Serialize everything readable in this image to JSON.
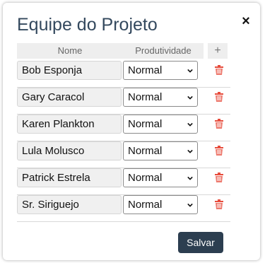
{
  "dialog": {
    "title": "Equipe do Projeto",
    "close_label": "×"
  },
  "table": {
    "headers": {
      "name": "Nome",
      "productivity": "Produtividade",
      "add": "+"
    },
    "rows": [
      {
        "name": "Bob Esponja",
        "productivity": "Normal"
      },
      {
        "name": "Gary Caracol",
        "productivity": "Normal"
      },
      {
        "name": "Karen Plankton",
        "productivity": "Normal"
      },
      {
        "name": "Lula Molusco",
        "productivity": "Normal"
      },
      {
        "name": "Patrick Estrela",
        "productivity": "Normal"
      },
      {
        "name": "Sr. Siriguejo",
        "productivity": "Normal"
      }
    ]
  },
  "footer": {
    "save_label": "Salvar"
  },
  "colors": {
    "title": "#34495e",
    "save_bg": "#2c3e50",
    "trash": "#e74c3c"
  },
  "icons": {
    "close": "close-icon",
    "add": "plus-icon",
    "delete": "trash-icon",
    "select": "chevron-down-icon"
  }
}
